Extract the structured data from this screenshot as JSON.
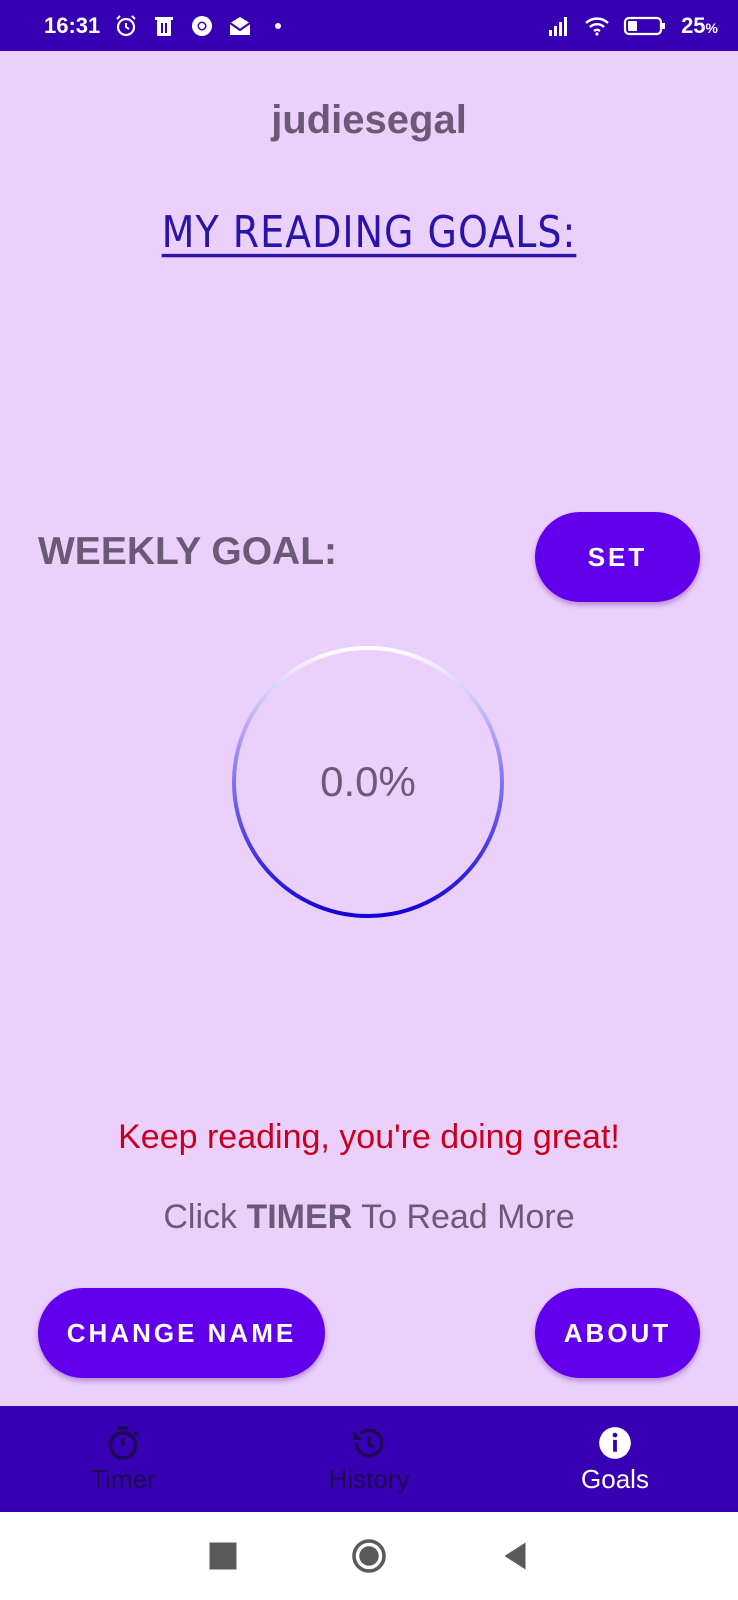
{
  "status_bar": {
    "time": "16:31",
    "icons": [
      "alarm-icon",
      "trash-icon",
      "chrome-icon",
      "mail-icon",
      "dot-icon"
    ],
    "right_icons": [
      "signal-icon",
      "wifi-icon",
      "battery-icon"
    ],
    "battery_percent": "25",
    "battery_unit": "%"
  },
  "main": {
    "username": "judiesegal",
    "title": "MY READING GOALS:",
    "weekly_label": "WEEKLY GOAL:",
    "set_button": "SET",
    "progress_text": "0.0%",
    "progress_value": 0.0,
    "encouragement": "Keep reading, you're doing great!",
    "hint_prefix": "Click ",
    "hint_bold": "TIMER",
    "hint_suffix": " To Read More",
    "change_name_button": "CHANGE NAME",
    "about_button": "ABOUT"
  },
  "bottom_nav": {
    "items": [
      {
        "label": "Timer",
        "icon": "stopwatch-icon",
        "active": false
      },
      {
        "label": "History",
        "icon": "history-icon",
        "active": false
      },
      {
        "label": "Goals",
        "icon": "info-icon",
        "active": true
      }
    ]
  },
  "colors": {
    "background": "#ecd0fc",
    "primary": "#6200ee",
    "primary_dark": "#3700b3",
    "encouragement": "#c8001e"
  }
}
